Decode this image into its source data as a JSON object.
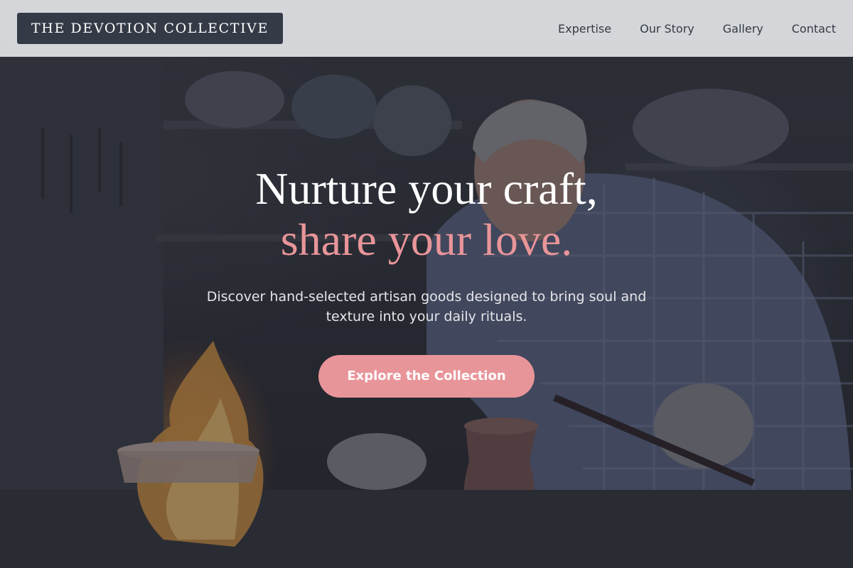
{
  "header": {
    "brand": "THE DEVOTION COLLECTIVE",
    "nav": [
      {
        "label": "Expertise"
      },
      {
        "label": "Our Story"
      },
      {
        "label": "Gallery"
      },
      {
        "label": "Contact"
      }
    ]
  },
  "hero": {
    "headline_line1": "Nurture your craft,",
    "headline_line2": "share your love.",
    "subtitle": "Discover hand-selected artisan goods designed to bring soul and texture into your daily rituals.",
    "cta_label": "Explore the Collection",
    "image_subject": "artisan coppersmith working at forge"
  },
  "colors": {
    "header_bg": "#dcdde0",
    "brand_bg": "#343a46",
    "accent_pink": "#e8959a",
    "text_white": "#ffffff"
  }
}
